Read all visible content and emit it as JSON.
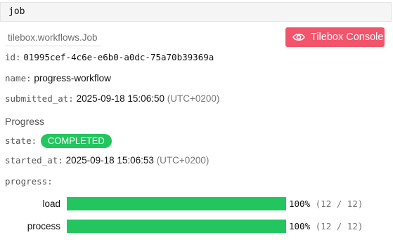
{
  "header": {
    "label": "job"
  },
  "job": {
    "class_name": "tilebox.workflows.Job",
    "console_button": "Tilebox Console",
    "fields": {
      "id": {
        "key": "id:",
        "value": "01995cef-4c6e-e6b0-a0dc-75a70b39369a"
      },
      "name": {
        "key": "name:",
        "value": "progress-workflow"
      },
      "submitted_at": {
        "key": "submitted_at:",
        "value": "2025-09-18 15:06:50",
        "tz": "(UTC+0200)"
      }
    }
  },
  "progress": {
    "title": "Progress",
    "state": {
      "key": "state:",
      "value": "COMPLETED",
      "color": "#22c55e"
    },
    "started_at": {
      "key": "started_at:",
      "value": "2025-09-18 15:06:53",
      "tz": "(UTC+0200)"
    },
    "progress_key": "progress:",
    "tasks": [
      {
        "label": "load",
        "fraction": 1.0,
        "percent": "100%",
        "count": "(12 / 12)"
      },
      {
        "label": "process",
        "fraction": 1.0,
        "percent": "100%",
        "count": "(12 / 12)"
      }
    ]
  },
  "colors": {
    "accent": "#f2546c",
    "success": "#22c55e"
  },
  "icons": {
    "console_icon": "eye-icon"
  }
}
